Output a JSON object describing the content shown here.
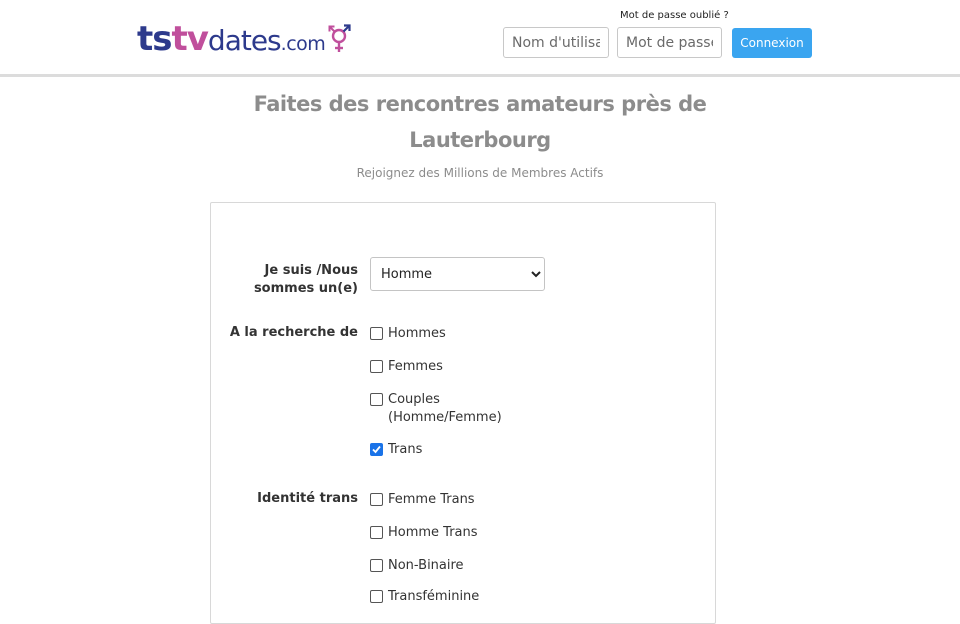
{
  "header": {
    "logo": {
      "ts": "ts",
      "tv": "tv",
      "dates": "dates",
      "com": ".com"
    },
    "forgot_password": "Mot de passe oublié ?",
    "username_placeholder": "Nom d'utilisateur",
    "password_placeholder": "Mot de passe",
    "login_label": "Connexion"
  },
  "hero": {
    "title": "Faites des rencontres amateurs près de Lauterbourg",
    "subtitle": "Rejoignez des Millions de Membres Actifs"
  },
  "form": {
    "iam_label": "Je suis /Nous sommes un(e)",
    "iam_selected": "Homme",
    "seeking_label": "A la recherche de",
    "seeking_options": [
      {
        "label": "Hommes",
        "checked": false
      },
      {
        "label": "Femmes",
        "checked": false
      },
      {
        "label": "Couples (Homme/Femme)",
        "checked": false
      },
      {
        "label": "Trans",
        "checked": true
      }
    ],
    "identity_label": "Identité trans",
    "identity_options": [
      {
        "label": "Femme Trans",
        "checked": false
      },
      {
        "label": "Homme Trans",
        "checked": false
      },
      {
        "label": "Non-Binaire",
        "checked": false
      },
      {
        "label": "Transféminine",
        "checked": false
      }
    ]
  },
  "colors": {
    "brand_blue": "#2d3a8c",
    "brand_pink": "#c04f9c",
    "button_blue": "#3aa5f0",
    "checkbox_checked": "#1a73e8"
  }
}
